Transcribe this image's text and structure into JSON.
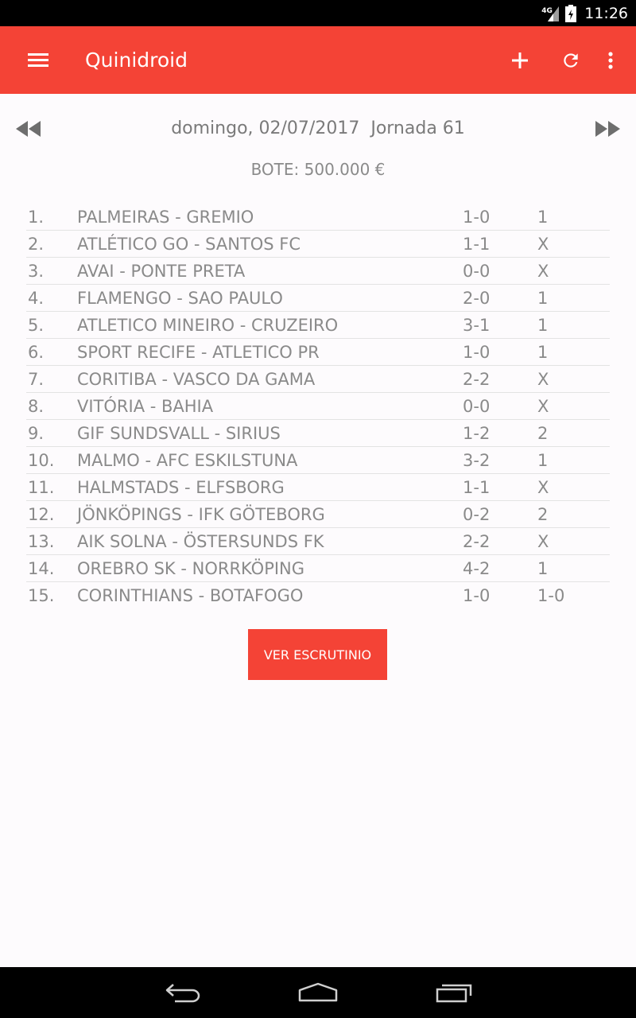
{
  "status_bar": {
    "network": "4G",
    "time": "11:26"
  },
  "app_bar": {
    "title": "Quinidroid",
    "icons": [
      "menu-icon",
      "plus-icon",
      "refresh-icon",
      "more-vert-icon"
    ]
  },
  "navigation": {
    "date": "domingo, 02/07/2017",
    "jornada": "Jornada 61",
    "icons": [
      "rewind-icon",
      "fast-forward-icon"
    ]
  },
  "bote": "BOTE: 500.000 €",
  "matches": [
    {
      "num": "1.",
      "teams": "PALMEIRAS - GREMIO",
      "score": "1-0",
      "sign": "1"
    },
    {
      "num": "2.",
      "teams": "ATLÉTICO GO - SANTOS FC",
      "score": "1-1",
      "sign": "X"
    },
    {
      "num": "3.",
      "teams": "AVAI - PONTE PRETA",
      "score": "0-0",
      "sign": "X"
    },
    {
      "num": "4.",
      "teams": "FLAMENGO - SAO PAULO",
      "score": "2-0",
      "sign": "1"
    },
    {
      "num": "5.",
      "teams": "ATLETICO MINEIRO - CRUZEIRO",
      "score": "3-1",
      "sign": "1"
    },
    {
      "num": "6.",
      "teams": "SPORT RECIFE - ATLETICO PR",
      "score": "1-0",
      "sign": "1"
    },
    {
      "num": "7.",
      "teams": "CORITIBA - VASCO DA GAMA",
      "score": "2-2",
      "sign": "X"
    },
    {
      "num": "8.",
      "teams": "VITÓRIA - BAHIA",
      "score": "0-0",
      "sign": "X"
    },
    {
      "num": "9.",
      "teams": "GIF SUNDSVALL - SIRIUS",
      "score": "1-2",
      "sign": "2"
    },
    {
      "num": "10.",
      "teams": "MALMO - AFC ESKILSTUNA",
      "score": "3-2",
      "sign": "1"
    },
    {
      "num": "11.",
      "teams": "HALMSTADS - ELFSBORG",
      "score": "1-1",
      "sign": "X"
    },
    {
      "num": "12.",
      "teams": "JÖNKÖPINGS - IFK GÖTEBORG",
      "score": "0-2",
      "sign": "2"
    },
    {
      "num": "13.",
      "teams": "AIK SOLNA - ÖSTERSUNDS FK",
      "score": "2-2",
      "sign": "X"
    },
    {
      "num": "14.",
      "teams": "OREBRO SK - NORRKÖPING",
      "score": "4-2",
      "sign": "1"
    },
    {
      "num": "15.",
      "teams": "CORINTHIANS - BOTAFOGO",
      "score": "1-0",
      "sign": "1-0"
    }
  ],
  "ver_escrutinio_label": "VER ESCRUTINIO",
  "colors": {
    "accent": "#f44336",
    "text": "#8a8a8a",
    "background": "#fdfbfd"
  },
  "system_nav": {
    "icons": [
      "back-icon",
      "home-icon",
      "recents-icon"
    ]
  }
}
